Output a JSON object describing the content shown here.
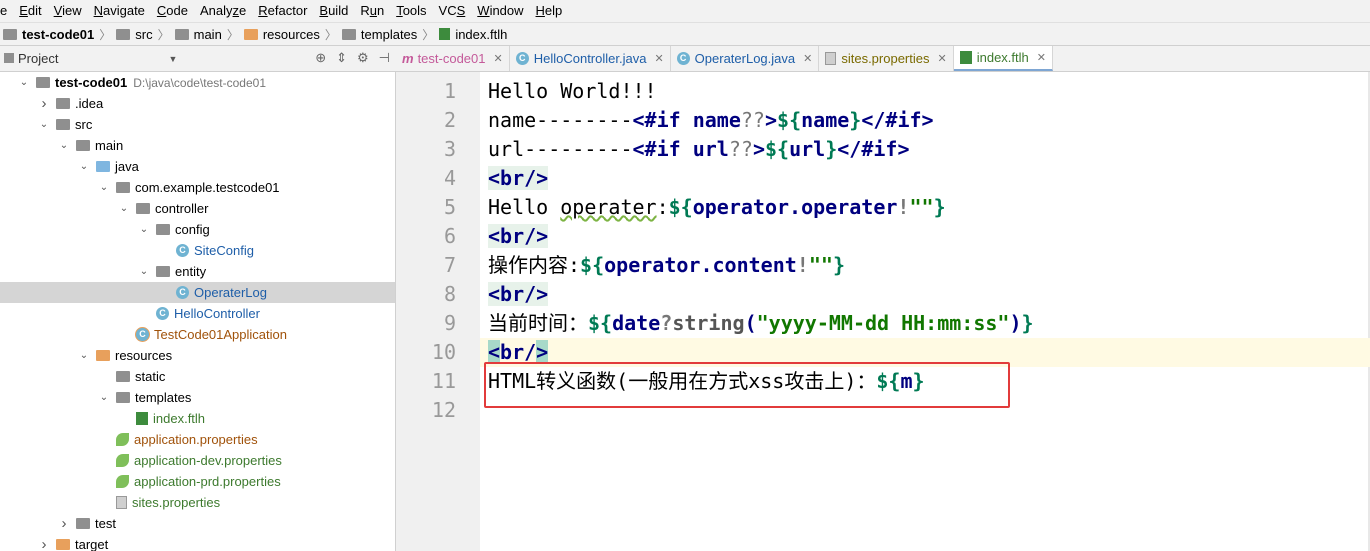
{
  "menu": [
    {
      "label": "e",
      "u": ""
    },
    {
      "label": "Edit",
      "u": "E"
    },
    {
      "label": "View",
      "u": "V"
    },
    {
      "label": "Navigate",
      "u": "N"
    },
    {
      "label": "Code",
      "u": "C"
    },
    {
      "label": "Analyze",
      "u": "z"
    },
    {
      "label": "Refactor",
      "u": "R"
    },
    {
      "label": "Build",
      "u": "B"
    },
    {
      "label": "Run",
      "u": "u"
    },
    {
      "label": "Tools",
      "u": "T"
    },
    {
      "label": "VCS",
      "u": "S"
    },
    {
      "label": "Window",
      "u": "W"
    },
    {
      "label": "Help",
      "u": "H"
    }
  ],
  "breadcrumb": [
    "test-code01",
    "src",
    "main",
    "resources",
    "templates",
    "index.ftlh"
  ],
  "project_panel": {
    "title": "Project"
  },
  "tree": [
    {
      "label": "test-code01",
      "extra": "D:\\java\\code\\test-code01",
      "indent": 0,
      "arrow": "down",
      "icon": "folder",
      "bold": true
    },
    {
      "label": ".idea",
      "indent": 1,
      "arrow": "right",
      "icon": "folder"
    },
    {
      "label": "src",
      "indent": 1,
      "arrow": "down",
      "icon": "folder"
    },
    {
      "label": "main",
      "indent": 2,
      "arrow": "down",
      "icon": "folder"
    },
    {
      "label": "java",
      "indent": 3,
      "arrow": "down",
      "icon": "folder-blue"
    },
    {
      "label": "com.example.testcode01",
      "indent": 4,
      "arrow": "down",
      "icon": "folder"
    },
    {
      "label": "controller",
      "indent": 5,
      "arrow": "down",
      "icon": "folder"
    },
    {
      "label": "config",
      "indent": 6,
      "arrow": "down",
      "icon": "folder"
    },
    {
      "label": "SiteConfig",
      "indent": 7,
      "arrow": "",
      "icon": "class",
      "color": "blue"
    },
    {
      "label": "entity",
      "indent": 6,
      "arrow": "down",
      "icon": "folder"
    },
    {
      "label": "OperaterLog",
      "indent": 7,
      "arrow": "",
      "icon": "class",
      "color": "blue",
      "selected": true
    },
    {
      "label": "HelloController",
      "indent": 6,
      "arrow": "",
      "icon": "class",
      "color": "blue"
    },
    {
      "label": "TestCode01Application",
      "indent": 5,
      "arrow": "",
      "icon": "class",
      "color": "orange"
    },
    {
      "label": "resources",
      "indent": 3,
      "arrow": "down",
      "icon": "folder-orange"
    },
    {
      "label": "static",
      "indent": 4,
      "arrow": "",
      "icon": "folder"
    },
    {
      "label": "templates",
      "indent": 4,
      "arrow": "down",
      "icon": "folder"
    },
    {
      "label": "index.ftlh",
      "indent": 5,
      "arrow": "",
      "icon": "ftl",
      "color": "green"
    },
    {
      "label": "application.properties",
      "indent": 4,
      "arrow": "",
      "icon": "leaf",
      "color": "orange"
    },
    {
      "label": "application-dev.properties",
      "indent": 4,
      "arrow": "",
      "icon": "leaf",
      "color": "green"
    },
    {
      "label": "application-prd.properties",
      "indent": 4,
      "arrow": "",
      "icon": "leaf",
      "color": "green"
    },
    {
      "label": "sites.properties",
      "indent": 4,
      "arrow": "",
      "icon": "file",
      "color": "green"
    },
    {
      "label": "test",
      "indent": 2,
      "arrow": "right",
      "icon": "folder"
    },
    {
      "label": "target",
      "indent": 1,
      "arrow": "right",
      "icon": "folder-orange"
    }
  ],
  "tabs": [
    {
      "label": "test-code01",
      "icon": "m",
      "color": "#c45a9a"
    },
    {
      "label": "HelloController.java",
      "icon": "class",
      "color": "#1e5ea8"
    },
    {
      "label": "OperaterLog.java",
      "icon": "class",
      "color": "#1e5ea8"
    },
    {
      "label": "sites.properties",
      "icon": "file",
      "color": "#7a6a00"
    },
    {
      "label": "index.ftlh",
      "icon": "ftl",
      "color": "#3d7a2e",
      "active": true
    }
  ],
  "editor": {
    "line_numbers": [
      "1",
      "2",
      "3",
      "4",
      "5",
      "6",
      "7",
      "8",
      "9",
      "10",
      "11",
      "12"
    ],
    "current_line": "10",
    "code": [
      "Hello World!!!",
      "name--------<#if name??>${name}</#if>",
      "url---------<#if url??>${url}</#if>",
      "<br/>",
      "Hello operater:${operator.operater!\"\"}",
      "<br/>",
      "操作内容:${operator.content!\"\"}",
      "<br/>",
      "当前时间：${date?string(\"yyyy-MM-dd HH:mm:ss\")}",
      "<br/>",
      "HTML转义函数(一般用在方式xss攻击上)：${m}",
      ""
    ]
  },
  "colors": {
    "accent": "#7ea6d3",
    "highlight_box": "#e23b3b",
    "current_line": "#fffae3"
  }
}
